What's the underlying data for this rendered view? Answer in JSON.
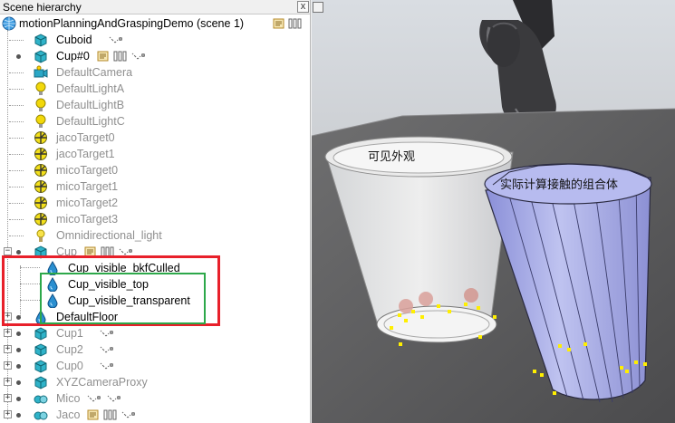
{
  "panel": {
    "title": "Scene hierarchy",
    "close_label": "x"
  },
  "tree": {
    "root": "motionPlanningAndGraspingDemo (scene 1)",
    "items": [
      {
        "label": "Cuboid"
      },
      {
        "label": "Cup#0"
      },
      {
        "label": "DefaultCamera"
      },
      {
        "label": "DefaultLightA"
      },
      {
        "label": "DefaultLightB"
      },
      {
        "label": "DefaultLightC"
      },
      {
        "label": "jacoTarget0"
      },
      {
        "label": "jacoTarget1"
      },
      {
        "label": "micoTarget0"
      },
      {
        "label": "micoTarget1"
      },
      {
        "label": "micoTarget2"
      },
      {
        "label": "micoTarget3"
      },
      {
        "label": "Omnidirectional_light"
      },
      {
        "label": "Cup"
      },
      {
        "label": "Cup_visible_bkfCulled"
      },
      {
        "label": "Cup_visible_top"
      },
      {
        "label": "Cup_visible_transparent"
      },
      {
        "label": "DefaultFloor"
      },
      {
        "label": "Cup1"
      },
      {
        "label": "Cup2"
      },
      {
        "label": "Cup0"
      },
      {
        "label": "XYZCameraProxy"
      },
      {
        "label": "Mico"
      },
      {
        "label": "Jaco"
      }
    ]
  },
  "viewport": {
    "label_visible": "可见外观",
    "label_collision": "实际计算接触的组合体"
  },
  "colors": {
    "highlight_red": "#e8202a",
    "highlight_green": "#2da84a",
    "shape_icon": "#2fb3c9",
    "light_icon": "#f2d80a",
    "dummy_icon": "#2a8fd0",
    "contact_point": "#ffef00"
  }
}
